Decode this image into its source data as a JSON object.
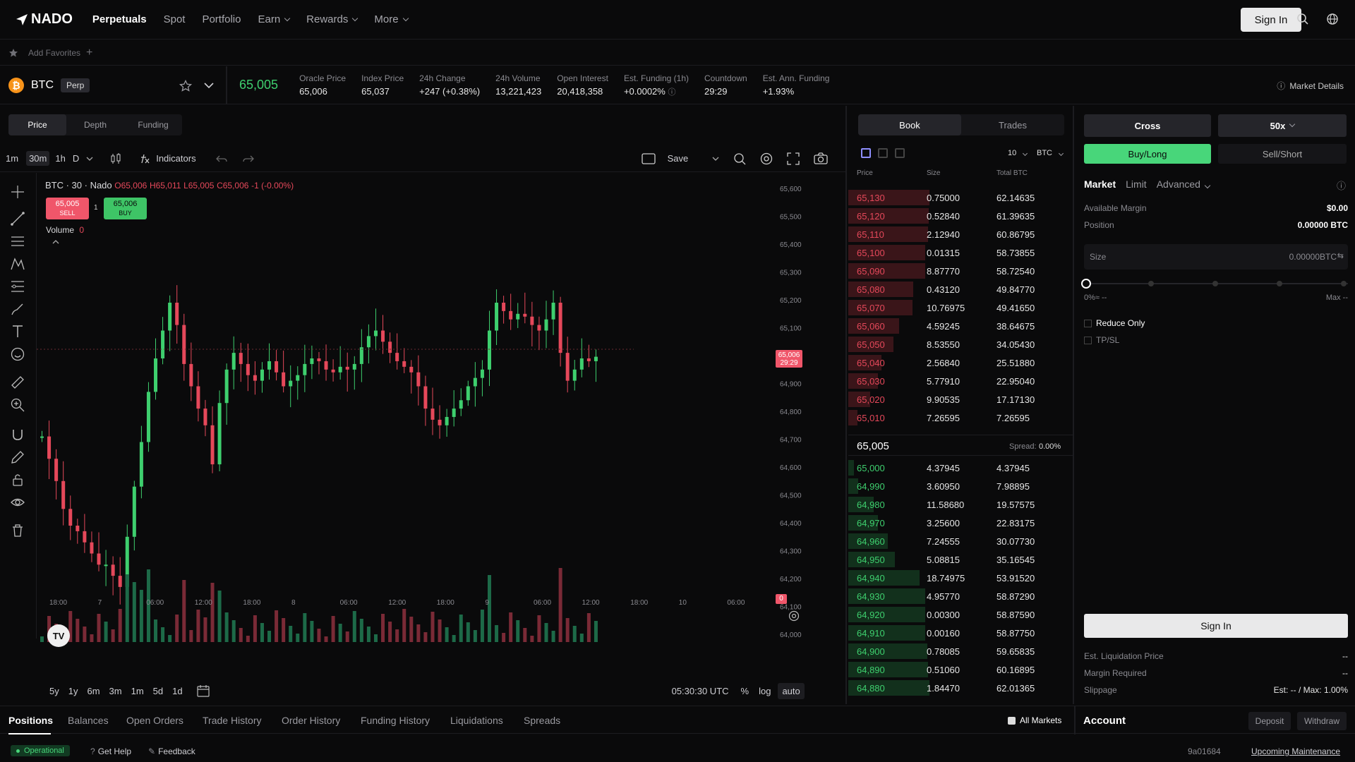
{
  "nav": {
    "logo": "NADO",
    "links": [
      {
        "label": "Perpetuals"
      },
      {
        "label": "Spot"
      },
      {
        "label": "Portfolio"
      },
      {
        "label": "Earn"
      },
      {
        "label": "Rewards"
      },
      {
        "label": "More"
      }
    ],
    "signin": "Sign In"
  },
  "favorites": {
    "label": "Add Favorites"
  },
  "market": {
    "symbol": "BTC",
    "badge": "Perp",
    "price": "65,005",
    "stats": [
      {
        "label": "Oracle Price",
        "value": "65,006",
        "color": "#e6e6e6"
      },
      {
        "label": "Index Price",
        "value": "65,037",
        "color": "#e6e6e6"
      },
      {
        "label": "24h Change",
        "value": "+247 (+0.38%)",
        "color": "#3ecf6e"
      },
      {
        "label": "24h Volume",
        "value": "13,221,423",
        "color": "#e6e6e6"
      },
      {
        "label": "Open Interest",
        "value": "20,418,358",
        "color": "#e6e6e6"
      },
      {
        "label": "Est. Funding (1h)",
        "value": "+0.0002%",
        "color": "#3ecf6e"
      },
      {
        "label": "Countdown",
        "value": "29:29",
        "color": "#e6e6e6"
      },
      {
        "label": "Est. Ann. Funding",
        "value": "+1.93%",
        "color": "#3ecf6e"
      }
    ],
    "details": "Market Details"
  },
  "chart": {
    "tabs": [
      "Price",
      "Depth",
      "Funding"
    ],
    "intervals": [
      "1m",
      "30m",
      "1h",
      "D"
    ],
    "indicators": "Indicators",
    "save": "Save",
    "legend_title": "BTC · 30 · Nado",
    "ohlc": {
      "o": "O65,006",
      "h": "H65,011",
      "l": "L65,005",
      "c": "C65,006",
      "chg": "-1 (-0.00%)"
    },
    "sell_price": "65,005",
    "sell_label": "SELL",
    "spread_num": "1",
    "buy_price": "65,006",
    "buy_label": "BUY",
    "volume_label": "Volume",
    "volume_value": "0",
    "price_tag": "65,006",
    "price_tag_time": "29:29",
    "vol_tag": "0",
    "ranges": [
      "5y",
      "1y",
      "6m",
      "3m",
      "1m",
      "5d",
      "1d"
    ],
    "time_utc": "05:30:30 UTC",
    "pct": "%",
    "log": "log",
    "auto": "auto"
  },
  "chart_data": {
    "type": "candlestick",
    "title": "BTC · 30 · Nado",
    "y_ticks": [
      "65,600",
      "65,500",
      "65,400",
      "65,300",
      "65,200",
      "65,100",
      "65,000",
      "64,900",
      "64,800",
      "64,700",
      "64,600",
      "64,500",
      "64,400",
      "64,300",
      "64,200",
      "64,100",
      "64,000"
    ],
    "x_ticks": [
      "18:00",
      "7",
      "06:00",
      "12:00",
      "18:00",
      "8",
      "06:00",
      "12:00",
      "18:00",
      "9",
      "06:00",
      "12:00",
      "18:00",
      "10",
      "06:00"
    ],
    "ylim": [
      63950,
      65650
    ],
    "last_price": 65006
  },
  "book": {
    "tabs": [
      "Book",
      "Trades"
    ],
    "depth": "10",
    "unit": "BTC",
    "headers": {
      "price": "Price",
      "size": "Size",
      "total": "Total BTC"
    },
    "asks": [
      {
        "price": "65,130",
        "size": "0.75000",
        "total": "62.14635",
        "depth": 0.96
      },
      {
        "price": "65,120",
        "size": "0.52840",
        "total": "61.39635",
        "depth": 0.95
      },
      {
        "price": "65,110",
        "size": "2.12940",
        "total": "60.86795",
        "depth": 0.94
      },
      {
        "price": "65,100",
        "size": "0.01315",
        "total": "58.73855",
        "depth": 0.91
      },
      {
        "price": "65,090",
        "size": "8.87770",
        "total": "58.72540",
        "depth": 0.91
      },
      {
        "price": "65,080",
        "size": "0.43120",
        "total": "49.84770",
        "depth": 0.77
      },
      {
        "price": "65,070",
        "size": "10.76975",
        "total": "49.41650",
        "depth": 0.76
      },
      {
        "price": "65,060",
        "size": "4.59245",
        "total": "38.64675",
        "depth": 0.6
      },
      {
        "price": "65,050",
        "size": "8.53550",
        "total": "34.05430",
        "depth": 0.53
      },
      {
        "price": "65,040",
        "size": "2.56840",
        "total": "25.51880",
        "depth": 0.39
      },
      {
        "price": "65,030",
        "size": "5.77910",
        "total": "22.95040",
        "depth": 0.35
      },
      {
        "price": "65,020",
        "size": "9.90535",
        "total": "17.17130",
        "depth": 0.26
      },
      {
        "price": "65,010",
        "size": "7.26595",
        "total": "7.26595",
        "depth": 0.11
      }
    ],
    "mid_price": "65,005",
    "spread_label": "Spread:",
    "spread_value": "0.00%",
    "bids": [
      {
        "price": "65,000",
        "size": "4.37945",
        "total": "4.37945",
        "depth": 0.07
      },
      {
        "price": "64,990",
        "size": "3.60950",
        "total": "7.98895",
        "depth": 0.12
      },
      {
        "price": "64,980",
        "size": "11.58680",
        "total": "19.57575",
        "depth": 0.3
      },
      {
        "price": "64,970",
        "size": "3.25600",
        "total": "22.83175",
        "depth": 0.35
      },
      {
        "price": "64,960",
        "size": "7.24555",
        "total": "30.07730",
        "depth": 0.47
      },
      {
        "price": "64,950",
        "size": "5.08815",
        "total": "35.16545",
        "depth": 0.55
      },
      {
        "price": "64,940",
        "size": "18.74975",
        "total": "53.91520",
        "depth": 0.84
      },
      {
        "price": "64,930",
        "size": "4.95770",
        "total": "58.87290",
        "depth": 0.91
      },
      {
        "price": "64,920",
        "size": "0.00300",
        "total": "58.87590",
        "depth": 0.91
      },
      {
        "price": "64,910",
        "size": "0.00160",
        "total": "58.87750",
        "depth": 0.91
      },
      {
        "price": "64,900",
        "size": "0.78085",
        "total": "59.65835",
        "depth": 0.93
      },
      {
        "price": "64,890",
        "size": "0.51060",
        "total": "60.16895",
        "depth": 0.94
      },
      {
        "price": "64,880",
        "size": "1.84470",
        "total": "62.01365",
        "depth": 0.96
      }
    ]
  },
  "form": {
    "margin_mode": "Cross",
    "leverage": "50x",
    "buy_long": "Buy/Long",
    "sell_short": "Sell/Short",
    "order_types": [
      "Market",
      "Limit",
      "Advanced"
    ],
    "available_margin_label": "Available Margin",
    "available_margin": "$0.00",
    "position_label": "Position",
    "position": "0.00000 BTC",
    "size_label": "Size",
    "size_value": "0.00000",
    "size_unit": "BTC",
    "slider_left": "0%≈ --",
    "slider_right": "Max --",
    "reduce_only": "Reduce Only",
    "tpsl": "TP/SL",
    "signin": "Sign In",
    "liq_label": "Est. Liquidation Price",
    "liq_value": "--",
    "margin_req_label": "Margin Required",
    "margin_req_value": "--",
    "slippage_label": "Slippage",
    "slippage_value": "Est: -- / Max: 1.00%",
    "account": "Account",
    "deposit": "Deposit",
    "withdraw": "Withdraw"
  },
  "bottom": {
    "tabs": [
      "Positions",
      "Balances",
      "Open Orders",
      "Trade History",
      "Order History",
      "Funding History",
      "Liquidations",
      "Spreads"
    ],
    "all_markets": "All Markets"
  },
  "status": {
    "operational": "Operational",
    "help": "Get Help",
    "feedback": "Feedback",
    "build": "9a01684",
    "maintenance": "Upcoming Maintenance"
  }
}
